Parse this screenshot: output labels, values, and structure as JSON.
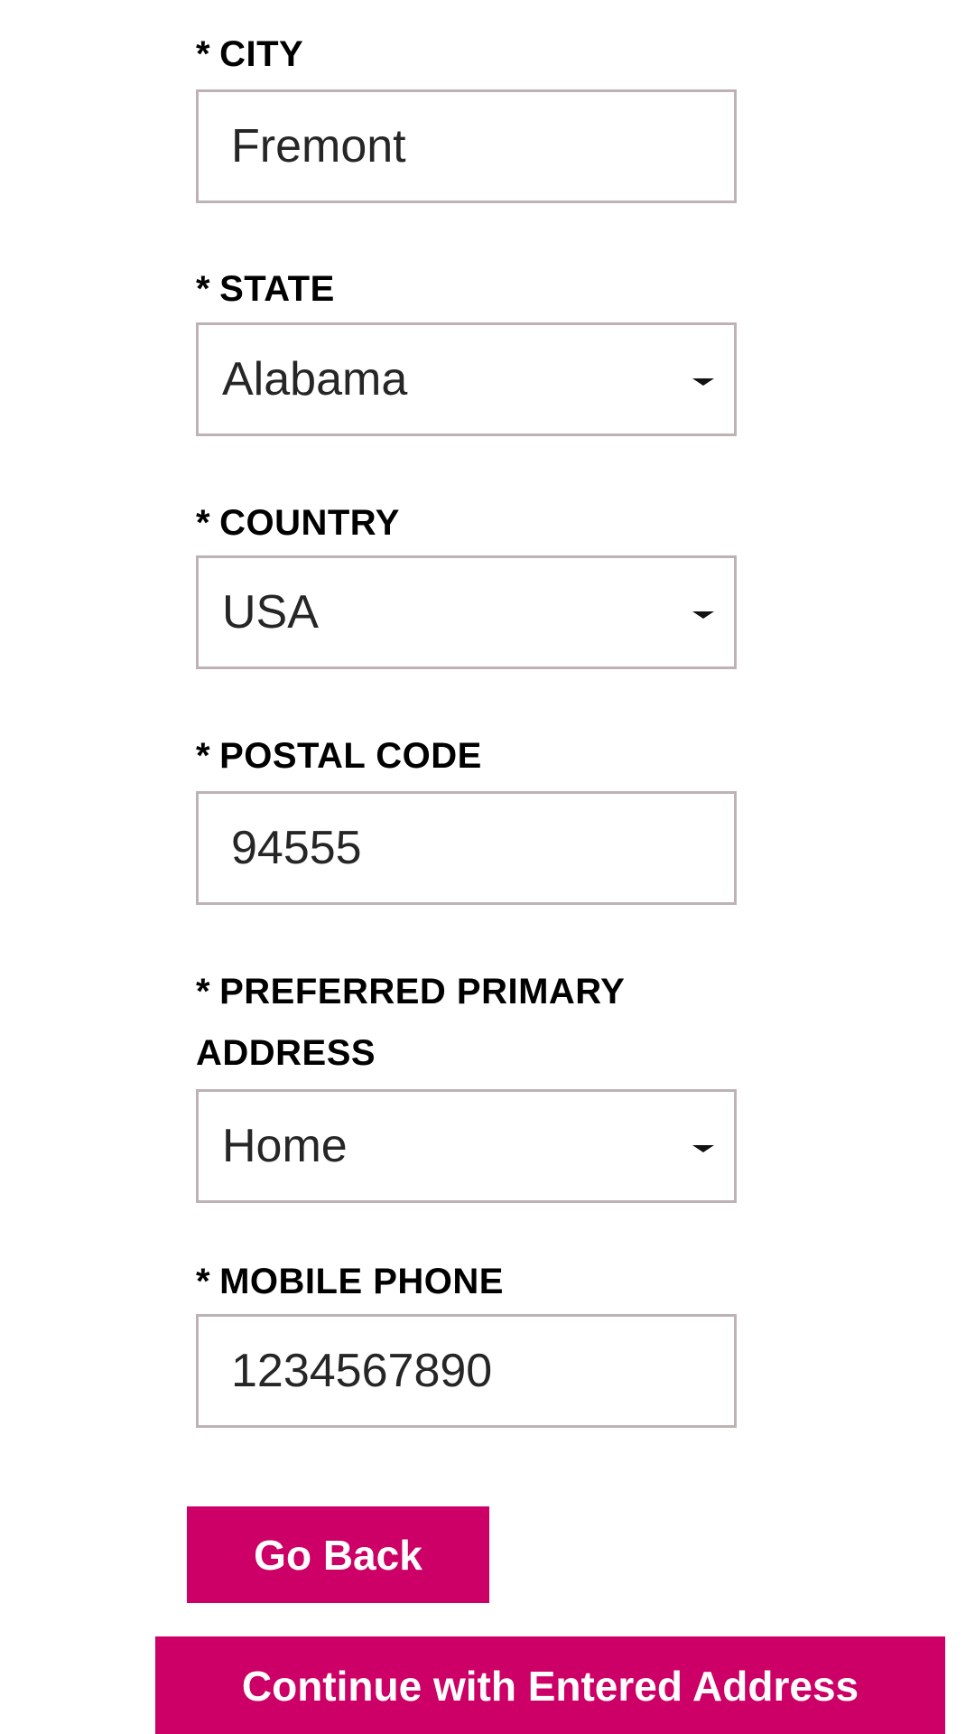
{
  "form": {
    "required_marker": "*",
    "city": {
      "label": "CITY",
      "value": "Fremont"
    },
    "state": {
      "label": "STATE",
      "value": "Alabama"
    },
    "country": {
      "label": "COUNTRY",
      "value": "USA"
    },
    "postal_code": {
      "label": "POSTAL CODE",
      "value": "94555"
    },
    "preferred_primary_address": {
      "label_line1": "PREFERRED PRIMARY",
      "label_line2": "ADDRESS",
      "value": "Home"
    },
    "mobile_phone": {
      "label": "MOBILE PHONE",
      "value": "1234567890"
    }
  },
  "actions": {
    "go_back_label": "Go Back",
    "continue_label": "Continue with Entered Address"
  },
  "colors": {
    "button_bg": "#cc0066",
    "button_text": "#ffffff",
    "field_border": "#bfb2b5",
    "label_text": "#000000",
    "value_text": "#262626"
  },
  "icons": {
    "dropdown": "chevron-down-icon"
  }
}
